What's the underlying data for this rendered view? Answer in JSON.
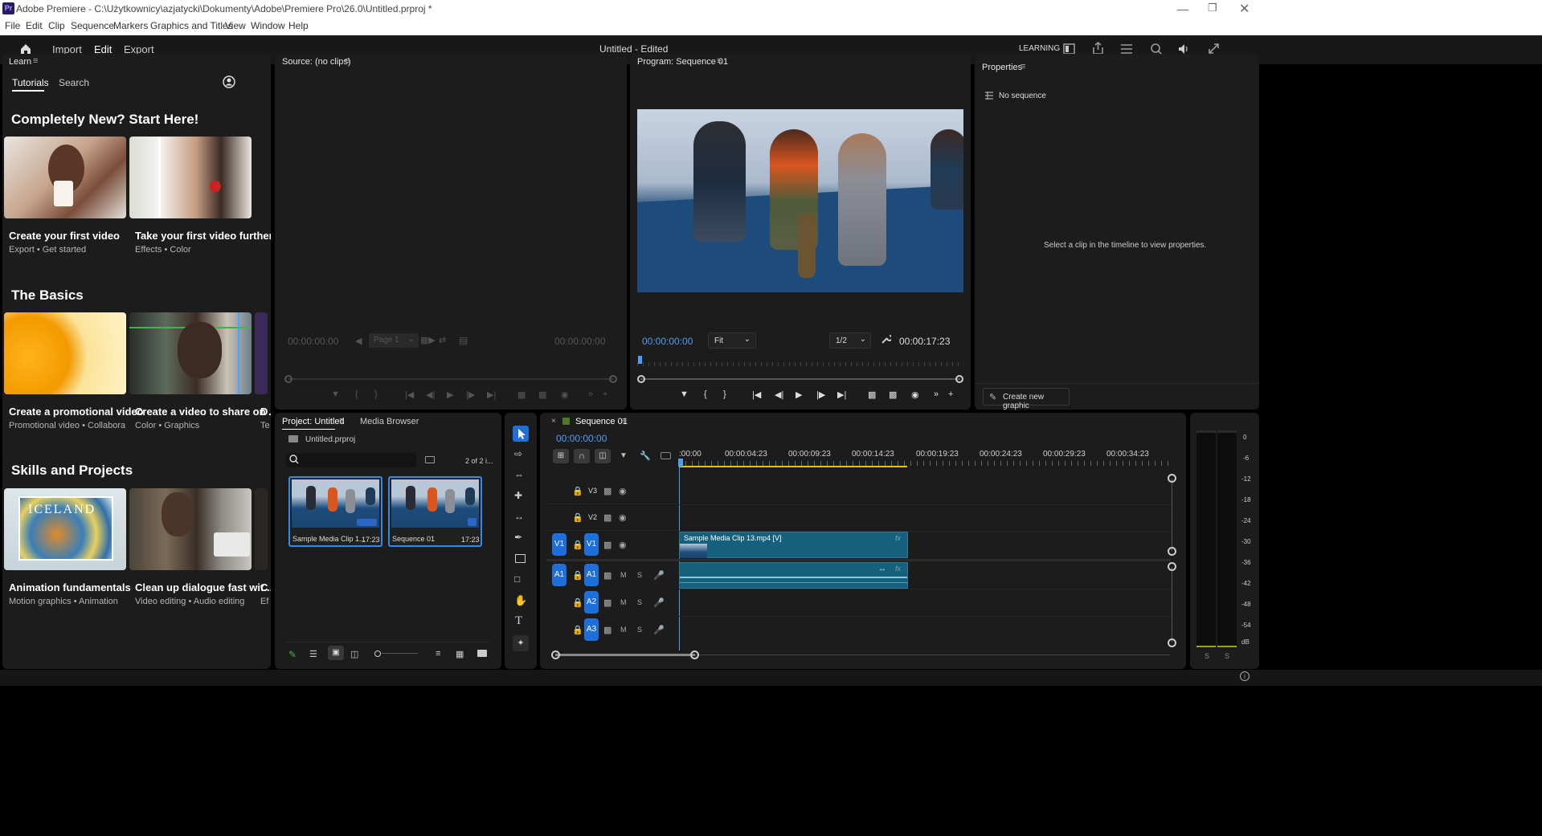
{
  "window": {
    "app_icon": "Pr",
    "title": "Adobe Premiere - C:\\Użytkownicy\\azjatycki\\Dokumenty\\Adobe\\Premiere Pro\\26.0\\Untitled.prproj *"
  },
  "menu": [
    "File",
    "Edit",
    "Clip",
    "Sequence",
    "Markers",
    "Graphics and Titles",
    "View",
    "Window",
    "Help"
  ],
  "workspace": {
    "tabs": [
      "Import",
      "Edit",
      "Export"
    ],
    "active_tab": "Edit",
    "doc_title": "Untitled - Edited",
    "workspace_name": "LEARNING"
  },
  "learn": {
    "panel_title": "Learn",
    "tabs": [
      "Tutorials",
      "Search"
    ],
    "sections": [
      {
        "title": "Completely New? Start Here!",
        "cards": [
          {
            "title": "Create your first video",
            "subtitle": "Export • Get started"
          },
          {
            "title": "Take your first video further",
            "subtitle": "Effects • Color"
          }
        ]
      },
      {
        "title": "The Basics",
        "cards": [
          {
            "title": "Create a promotional video",
            "subtitle": "Promotional video • Collaboration"
          },
          {
            "title": "Create a video to share on ...",
            "subtitle": "Color • Graphics"
          },
          {
            "title": "D",
            "subtitle": "Te"
          }
        ]
      },
      {
        "title": "Skills and Projects",
        "cards": [
          {
            "title": "Animation fundamentals",
            "subtitle": "Motion graphics • Animation",
            "overlay": "ICELAND"
          },
          {
            "title": "Clean up dialogue fast wit...",
            "subtitle": "Video editing • Audio editing"
          },
          {
            "title": "C",
            "subtitle": "Ef"
          }
        ]
      }
    ]
  },
  "source": {
    "panel_title": "Source: (no clips)",
    "timecode_in": "00:00:00:00",
    "timecode_out": "00:00:00:00",
    "page_select": "Page 1"
  },
  "program": {
    "panel_title": "Program: Sequence 01",
    "timecode": "00:00:00:00",
    "fit": "Fit",
    "resolution": "1/2",
    "duration": "00:00:17:23"
  },
  "properties": {
    "panel_title": "Properties",
    "no_sequence": "No sequence",
    "hint": "Select a clip in the timeline to view properties.",
    "create_button": "Create new graphic"
  },
  "project": {
    "tabs": [
      "Project: Untitled",
      "Media Browser"
    ],
    "file": "Untitled.prproj",
    "count": "2 of 2 i...",
    "items": [
      {
        "name": "Sample Media Clip 1...",
        "duration": "17:23"
      },
      {
        "name": "Sequence 01",
        "duration": "17:23"
      }
    ]
  },
  "timeline": {
    "sequence_name": "Sequence 01",
    "timecode": "00:00:00:00",
    "ruler": [
      ":00:00",
      "00:00:04:23",
      "00:00:09:23",
      "00:00:14:23",
      "00:00:19:23",
      "00:00:24:23",
      "00:00:29:23",
      "00:00:34:23"
    ],
    "video_tracks": [
      "V3",
      "V2",
      "V1"
    ],
    "audio_tracks": [
      "A1",
      "A2",
      "A3"
    ],
    "source_patch_video": "V1",
    "source_patch_audio": "A1",
    "mute_label": "M",
    "solo_label": "S",
    "clip_name": "Sample Media Clip 13.mp4 [V]",
    "fx_label": "fx"
  },
  "audio_meter": {
    "scale": [
      "0",
      "-6",
      "-12",
      "-18",
      "-24",
      "-30",
      "-36",
      "-42",
      "-48",
      "-54",
      "dB"
    ],
    "solo_labels": [
      "S",
      "S"
    ]
  },
  "colors": {
    "accent_blue": "#2d8ceb",
    "timecode_blue": "#4f9cf3",
    "clip_teal": "#15607c",
    "track_blue": "#1e6fd9",
    "work_area_yellow": "#e5c400"
  }
}
